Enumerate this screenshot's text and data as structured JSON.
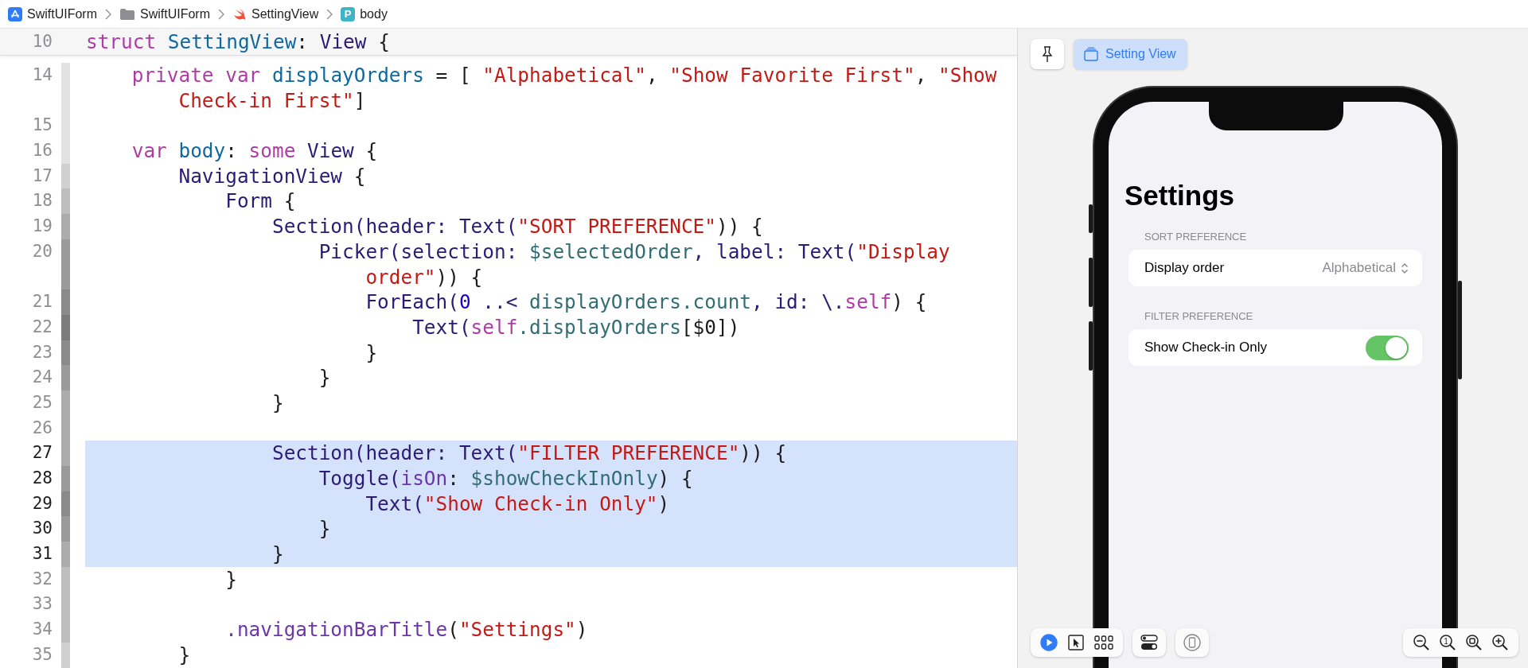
{
  "breadcrumb": [
    {
      "kind": "app",
      "label": "SwiftUIForm"
    },
    {
      "kind": "folder",
      "label": "SwiftUIForm"
    },
    {
      "kind": "swift",
      "label": "SettingView"
    },
    {
      "kind": "property",
      "badge": "P",
      "label": "body"
    }
  ],
  "editor": {
    "sticky_line": {
      "number": "10",
      "segments": [
        {
          "kind": "kw",
          "text": "struct"
        },
        {
          "kind": "decl",
          "text": " SettingView"
        },
        {
          "kind": "p",
          "text": ": "
        },
        {
          "kind": "ident",
          "text": "View"
        },
        {
          "kind": "p",
          "text": " {"
        }
      ]
    },
    "lines": [
      {
        "number": "14",
        "highlighted": false,
        "segments": [
          {
            "kind": "kw",
            "text": "    private var"
          },
          {
            "kind": "decl",
            "text": " displayOrders"
          },
          {
            "kind": "p",
            "text": " = [ "
          },
          {
            "kind": "str",
            "text": "\"Alphabetical\""
          },
          {
            "kind": "p",
            "text": ", "
          },
          {
            "kind": "str",
            "text": "\"Show Favorite First\""
          },
          {
            "kind": "p",
            "text": ", "
          },
          {
            "kind": "str",
            "text": "\"Show"
          }
        ],
        "continuation": [
          {
            "kind": "str",
            "text": "        Check-in First\""
          },
          {
            "kind": "p",
            "text": "]"
          }
        ]
      },
      {
        "number": "15",
        "highlighted": false
      },
      {
        "number": "16",
        "highlighted": false,
        "segments": [
          {
            "kind": "kw",
            "text": "    var"
          },
          {
            "kind": "decl",
            "text": " body"
          },
          {
            "kind": "p",
            "text": ": "
          },
          {
            "kind": "kw",
            "text": "some"
          },
          {
            "kind": "ident",
            "text": " View"
          },
          {
            "kind": "p",
            "text": " {"
          }
        ]
      },
      {
        "number": "17",
        "highlighted": false,
        "segments": [
          {
            "kind": "ident",
            "text": "        NavigationView"
          },
          {
            "kind": "p",
            "text": " {"
          }
        ]
      },
      {
        "number": "18",
        "highlighted": false,
        "segments": [
          {
            "kind": "ident",
            "text": "            Form"
          },
          {
            "kind": "p",
            "text": " {"
          }
        ]
      },
      {
        "number": "19",
        "highlighted": false,
        "segments": [
          {
            "kind": "ident",
            "text": "                Section(header: Text("
          },
          {
            "kind": "str",
            "text": "\"SORT PREFERENCE\""
          },
          {
            "kind": "p",
            "text": ")) {"
          }
        ]
      },
      {
        "number": "20",
        "highlighted": false,
        "segments": [
          {
            "kind": "ident",
            "text": "                    Picker(selection: "
          },
          {
            "kind": "var",
            "text": "$selectedOrder"
          },
          {
            "kind": "ident",
            "text": ", label: Text("
          },
          {
            "kind": "str",
            "text": "\"Display"
          }
        ],
        "continuation": [
          {
            "kind": "str",
            "text": "                        order\""
          },
          {
            "kind": "p",
            "text": ")) {"
          }
        ]
      },
      {
        "number": "21",
        "highlighted": false,
        "segments": [
          {
            "kind": "ident",
            "text": "                        ForEach("
          },
          {
            "kind": "num",
            "text": "0"
          },
          {
            "kind": "ident",
            "text": " ..< "
          },
          {
            "kind": "var",
            "text": "displayOrders.count"
          },
          {
            "kind": "ident",
            "text": ", id: \\."
          },
          {
            "kind": "kw",
            "text": "self"
          },
          {
            "kind": "p",
            "text": ") {"
          }
        ]
      },
      {
        "number": "22",
        "highlighted": false,
        "segments": [
          {
            "kind": "ident",
            "text": "                            Text("
          },
          {
            "kind": "kw",
            "text": "self"
          },
          {
            "kind": "var",
            "text": ".displayOrders"
          },
          {
            "kind": "p",
            "text": "[$0])"
          }
        ]
      },
      {
        "number": "23",
        "highlighted": false,
        "segments": [
          {
            "kind": "p",
            "text": "                        }"
          }
        ]
      },
      {
        "number": "24",
        "highlighted": false,
        "segments": [
          {
            "kind": "p",
            "text": "                    }"
          }
        ]
      },
      {
        "number": "25",
        "highlighted": false,
        "segments": [
          {
            "kind": "p",
            "text": "                }"
          }
        ]
      },
      {
        "number": "26",
        "highlighted": false
      },
      {
        "number": "27",
        "highlighted": true,
        "segments": [
          {
            "kind": "ident",
            "text": "                Section(header: Text("
          },
          {
            "kind": "str",
            "text": "\"FILTER PREFERENCE\""
          },
          {
            "kind": "p",
            "text": ")) {"
          }
        ]
      },
      {
        "number": "28",
        "highlighted": true,
        "segments": [
          {
            "kind": "ident",
            "text": "                    Toggle("
          },
          {
            "kind": "member",
            "text": "isOn"
          },
          {
            "kind": "p",
            "text": ": "
          },
          {
            "kind": "var",
            "text": "$showCheckInOnly"
          },
          {
            "kind": "p",
            "text": ") {"
          }
        ]
      },
      {
        "number": "29",
        "highlighted": true,
        "segments": [
          {
            "kind": "ident",
            "text": "                        Text("
          },
          {
            "kind": "str",
            "text": "\"Show Check-in Only\""
          },
          {
            "kind": "p",
            "text": ")"
          }
        ]
      },
      {
        "number": "30",
        "highlighted": true,
        "segments": [
          {
            "kind": "p",
            "text": "                    }"
          }
        ]
      },
      {
        "number": "31",
        "highlighted": true,
        "segments": [
          {
            "kind": "p",
            "text": "                }"
          }
        ]
      },
      {
        "number": "32",
        "highlighted": false,
        "segments": [
          {
            "kind": "p",
            "text": "            }"
          }
        ]
      },
      {
        "number": "33",
        "highlighted": false
      },
      {
        "number": "34",
        "highlighted": false,
        "segments": [
          {
            "kind": "member",
            "text": "            .navigationBarTitle"
          },
          {
            "kind": "p",
            "text": "("
          },
          {
            "kind": "str",
            "text": "\"Settings\""
          },
          {
            "kind": "p",
            "text": ")"
          }
        ]
      },
      {
        "number": "35",
        "highlighted": false,
        "segments": [
          {
            "kind": "p",
            "text": "        }"
          }
        ]
      }
    ]
  },
  "preview": {
    "title": "Setting View",
    "screen": {
      "title": "Settings",
      "sections": [
        {
          "header": "SORT PREFERENCE",
          "rows": [
            {
              "kind": "picker",
              "label": "Display order",
              "value": "Alphabetical"
            }
          ]
        },
        {
          "header": "FILTER PREFERENCE",
          "rows": [
            {
              "kind": "toggle",
              "label": "Show Check-in Only",
              "on": true
            }
          ]
        }
      ]
    },
    "modes": [
      {
        "kind": "live",
        "selected": true
      },
      {
        "kind": "select",
        "selected": false
      },
      {
        "kind": "variants",
        "selected": false
      }
    ],
    "zoom_controls": [
      {
        "kind": "out"
      },
      {
        "kind": "actual",
        "label": "1"
      },
      {
        "kind": "fit"
      },
      {
        "kind": "in"
      }
    ]
  }
}
